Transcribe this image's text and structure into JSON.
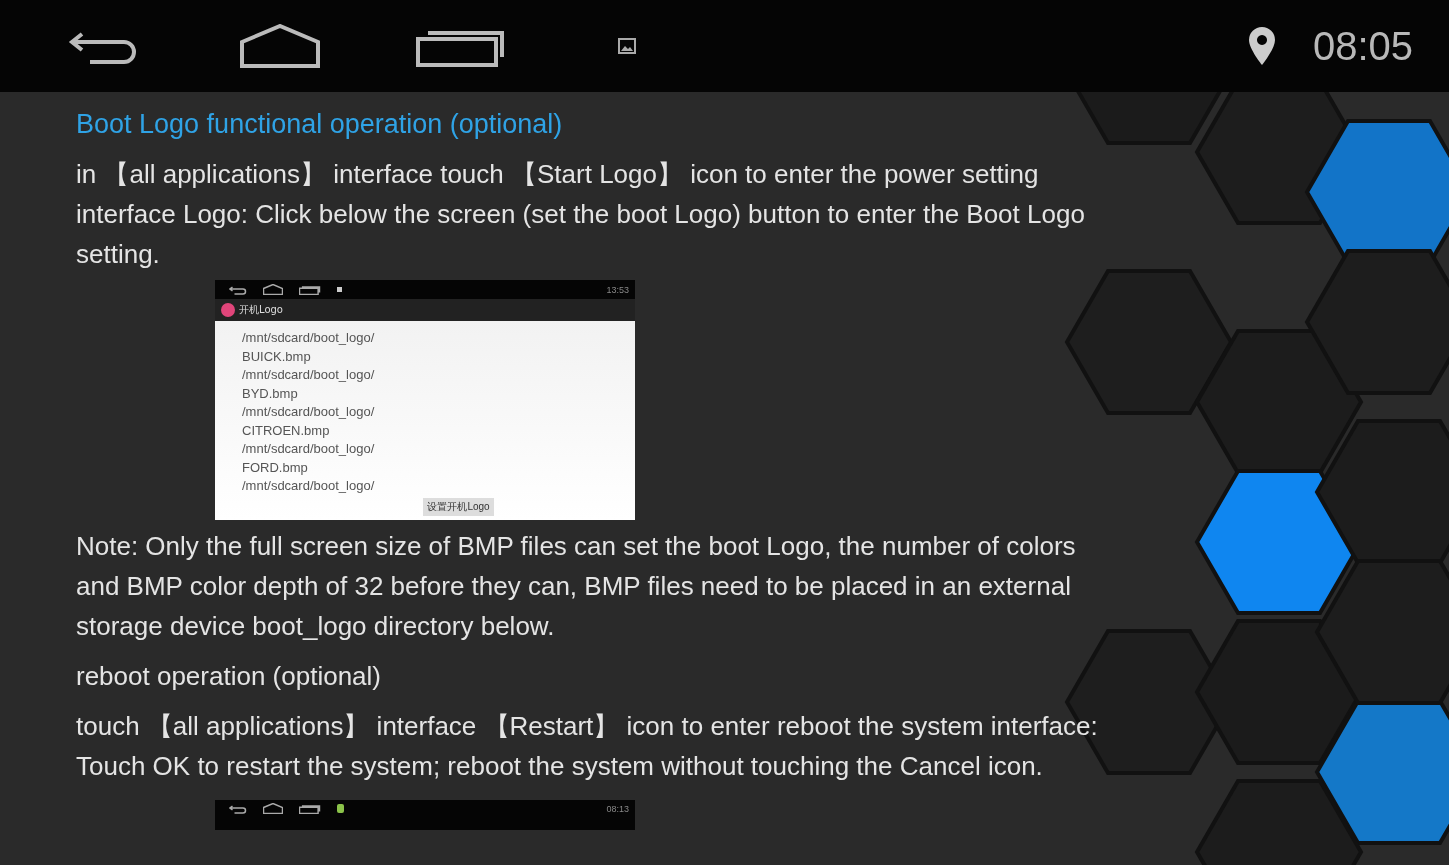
{
  "status_bar": {
    "time": "08:05"
  },
  "section_title": "Boot Logo functional operation (optional)",
  "intro": "in 【all applications】 interface touch 【Start Logo】 icon to enter the power setting interface Logo: Click below the screen (set the boot Logo) button to enter the Boot Logo setting.",
  "logo_screenshot": {
    "time": "13:53",
    "app_title": "开机Logo",
    "files": [
      {
        "path": "/mnt/sdcard/boot_logo/",
        "name": "BUICK.bmp"
      },
      {
        "path": "/mnt/sdcard/boot_logo/",
        "name": "BYD.bmp"
      },
      {
        "path": "/mnt/sdcard/boot_logo/",
        "name": "CITROEN.bmp"
      },
      {
        "path": "/mnt/sdcard/boot_logo/",
        "name": "FORD.bmp"
      },
      {
        "path": "/mnt/sdcard/boot_logo/"
      }
    ],
    "button": "设置开机Logo"
  },
  "note": "Note: Only the full screen size of BMP files can set the boot Logo, the number of colors and BMP color depth of 32 before they can, BMP files need to be placed in an external storage device boot_logo directory below.",
  "reboot_heading": "reboot operation (optional)",
  "reboot_text": "touch 【all applications】 interface 【Restart】 icon to enter reboot the system interface: Touch OK to restart the system; reboot the system without touching the Cancel icon.",
  "reboot_screenshot": {
    "time": "08:13"
  }
}
